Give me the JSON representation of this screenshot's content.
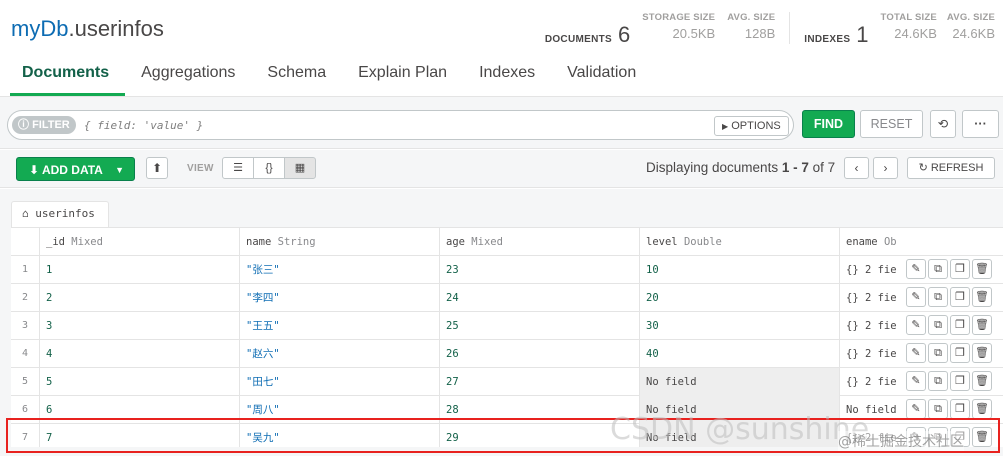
{
  "header": {
    "db": "myDb",
    "dot": ".",
    "collection": "userinfos"
  },
  "stats": {
    "documents_label": "DOCUMENTS",
    "documents_value": "6",
    "storage_label": "STORAGE SIZE",
    "storage_value": "20.5KB",
    "avg_label": "AVG. SIZE",
    "avg_value": "128B",
    "indexes_label": "INDEXES",
    "indexes_value": "1",
    "total_label": "TOTAL SIZE",
    "total_value": "24.6KB",
    "avg2_label": "AVG. SIZE",
    "avg2_value": "24.6KB"
  },
  "tabs": [
    {
      "label": "Documents"
    },
    {
      "label": "Aggregations"
    },
    {
      "label": "Schema"
    },
    {
      "label": "Explain Plan"
    },
    {
      "label": "Indexes"
    },
    {
      "label": "Validation"
    }
  ],
  "querybar": {
    "filter_label": "FILTER",
    "filter_placeholder": "{ field: 'value' }",
    "options_label": "OPTIONS",
    "find_label": "FIND",
    "reset_label": "RESET",
    "more_label": "···"
  },
  "controls": {
    "add_data_label": "ADD DATA",
    "view_label": "VIEW",
    "display_prefix": "Displaying documents ",
    "display_range": "1 - 7",
    "display_of": " of ",
    "display_total": "7",
    "refresh_label": "REFRESH"
  },
  "collection_tab": "userinfos",
  "columns": [
    {
      "name": "_id",
      "type": "Mixed"
    },
    {
      "name": "name",
      "type": "String"
    },
    {
      "name": "age",
      "type": "Mixed"
    },
    {
      "name": "level",
      "type": "Double"
    },
    {
      "name": "ename",
      "type": "Ob"
    }
  ],
  "rows": [
    {
      "idx": "1",
      "id": "1",
      "name": "\"张三\"",
      "age": "23",
      "level": "10",
      "ename": "{} 2 fie"
    },
    {
      "idx": "2",
      "id": "2",
      "name": "\"李四\"",
      "age": "24",
      "level": "20",
      "ename": "{} 2 fie"
    },
    {
      "idx": "3",
      "id": "3",
      "name": "\"王五\"",
      "age": "25",
      "level": "30",
      "ename": "{} 2 fie"
    },
    {
      "idx": "4",
      "id": "4",
      "name": "\"赵六\"",
      "age": "26",
      "level": "40",
      "ename": "{} 2 fie"
    },
    {
      "idx": "5",
      "id": "5",
      "name": "\"田七\"",
      "age": "27",
      "level": "No field",
      "ename": "{} 2 fie"
    },
    {
      "idx": "6",
      "id": "6",
      "name": "\"周八\"",
      "age": "28",
      "level": "No field",
      "ename": "No field"
    },
    {
      "idx": "7",
      "id": "7",
      "name": "\"吴九\"",
      "age": "29",
      "level": "No field",
      "ename": "{} 2 fie"
    }
  ],
  "watermark": "CSDN @sunshine",
  "watermark2": "@稀土掘金技术社区",
  "colors": {
    "accent": "#13aa52",
    "highlight": "#e8221f"
  }
}
